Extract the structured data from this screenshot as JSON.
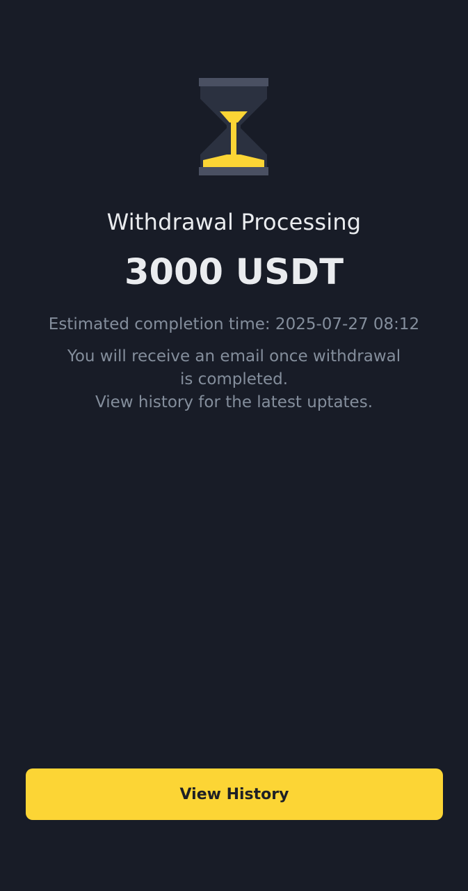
{
  "status": {
    "icon": "hourglass-icon",
    "title": "Withdrawal Processing",
    "amount": "3000 USDT",
    "estimated_completion": "Estimated completion time: 2025-07-27 08:12",
    "note_lines": [
      "You will receive an email once withdrawal",
      "is completed.",
      "View history for the latest uptates."
    ]
  },
  "actions": {
    "view_history_label": "View History"
  },
  "colors": {
    "background": "#181c27",
    "accent": "#fcd535",
    "primary_text": "#eaecef",
    "secondary_text": "#848e9c",
    "icon_frame": "#4a5062"
  }
}
